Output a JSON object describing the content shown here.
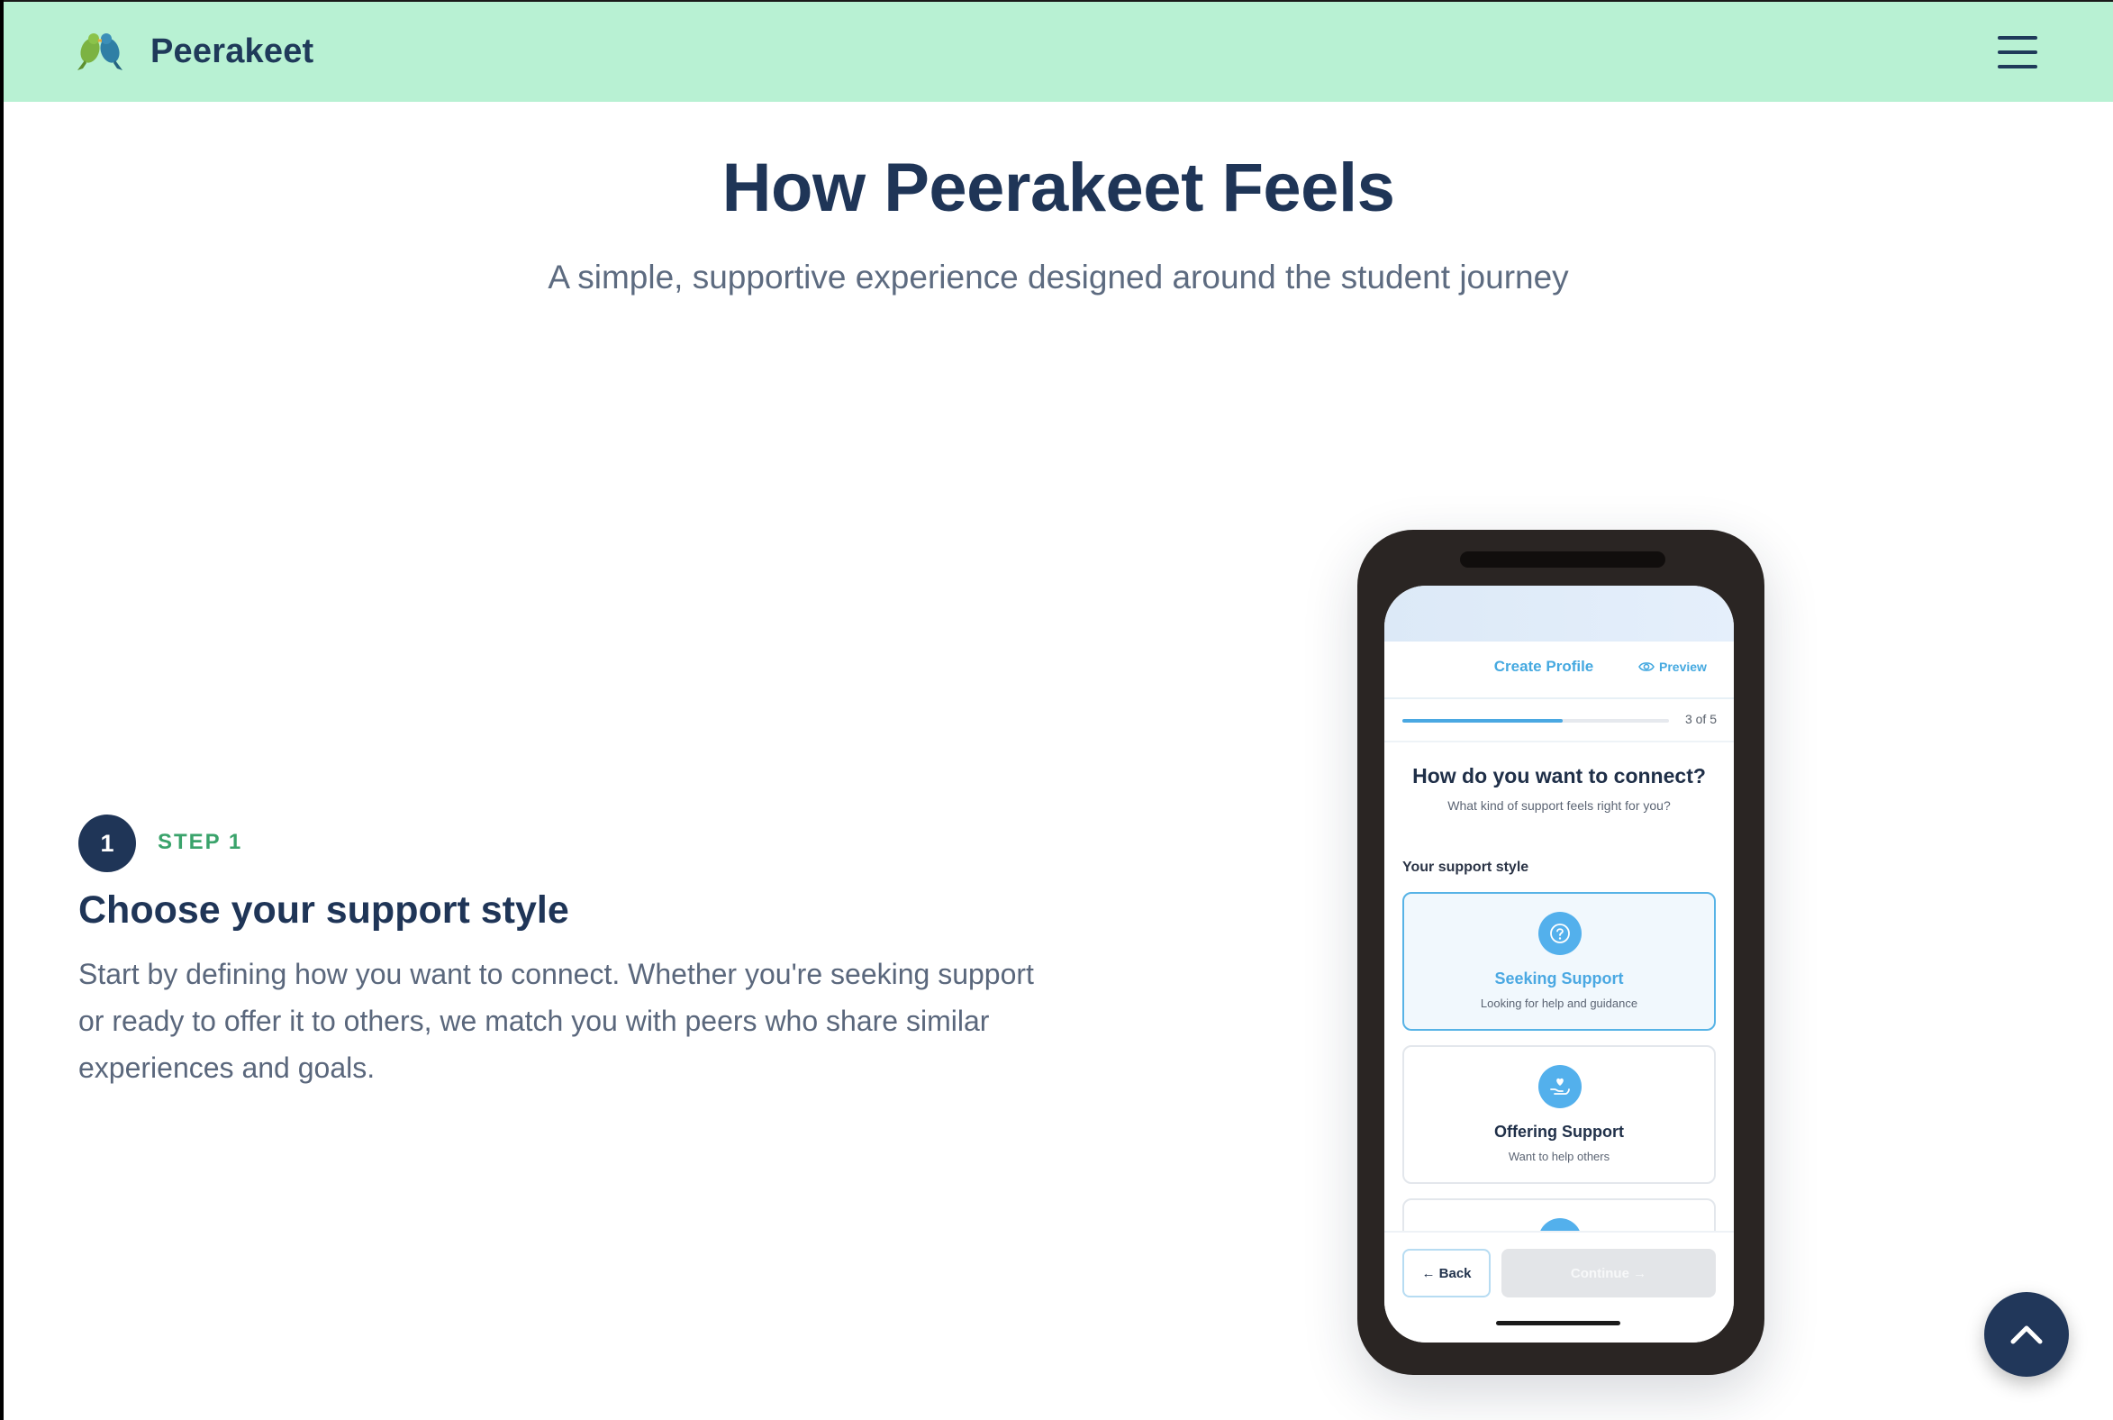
{
  "brand": {
    "name": "Peerakeet"
  },
  "hero": {
    "title": "How Peerakeet Feels",
    "subtitle": "A simple, supportive experience designed around the student journey"
  },
  "step": {
    "number": "1",
    "label": "STEP 1",
    "title": "Choose your support style",
    "description": "Start by defining how you want to connect. Whether you're seeking support or ready to offer it to others, we match you with peers who share similar experiences and goals."
  },
  "phone": {
    "header_title": "Create Profile",
    "preview_label": "Preview",
    "progress_text": "3 of 5",
    "progress_fraction": 0.6,
    "question": "How do you want to connect?",
    "question_sub": "What kind of support feels right for you?",
    "section_label": "Your support style",
    "options": [
      {
        "title": "Seeking Support",
        "subtitle": "Looking for help and guidance",
        "icon": "question-circle-icon",
        "selected": true
      },
      {
        "title": "Offering Support",
        "subtitle": "Want to help others",
        "icon": "heart-hand-icon",
        "selected": false
      }
    ],
    "back_label": "← Back",
    "continue_label": "Continue →"
  },
  "colors": {
    "header_bg": "#b8f1d3",
    "navy": "#1f3557",
    "step_green": "#3aa36b",
    "accent_blue": "#4aa8e2"
  }
}
